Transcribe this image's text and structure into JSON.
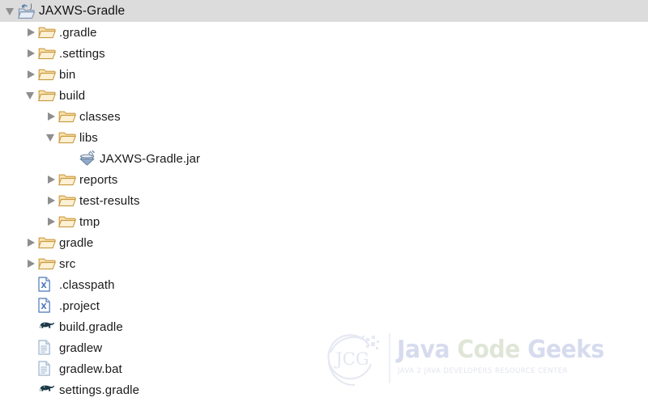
{
  "window": {
    "title": "JAXWS-Gradle"
  },
  "colors": {
    "header_band": "#dcdcdc",
    "background": "#ffffff",
    "text": "#1a1a1a",
    "twisty": "#8e8e8e",
    "folder_fill": "#fbe2b0",
    "folder_stroke": "#c99a3f",
    "xml_icon_accent": "#4a78b8",
    "gradle_icon": "#1c3a4a",
    "jar_icon": "#6f8fb5",
    "watermark_blue": "#d6dbee",
    "watermark_green": "#dfe6d8"
  },
  "tree": {
    "nodes": [
      {
        "label": "JAXWS-Gradle",
        "depth": 0,
        "icon": "java-project-folder-icon",
        "state": "expanded",
        "selected": true
      },
      {
        "label": ".gradle",
        "depth": 1,
        "icon": "folder-icon",
        "state": "collapsed",
        "selected": false
      },
      {
        "label": ".settings",
        "depth": 1,
        "icon": "folder-icon",
        "state": "collapsed",
        "selected": false
      },
      {
        "label": "bin",
        "depth": 1,
        "icon": "folder-icon",
        "state": "collapsed",
        "selected": false
      },
      {
        "label": "build",
        "depth": 1,
        "icon": "folder-icon",
        "state": "expanded",
        "selected": false
      },
      {
        "label": "classes",
        "depth": 2,
        "icon": "folder-icon",
        "state": "collapsed",
        "selected": false
      },
      {
        "label": "libs",
        "depth": 2,
        "icon": "folder-icon",
        "state": "expanded",
        "selected": false
      },
      {
        "label": "JAXWS-Gradle.jar",
        "depth": 3,
        "icon": "jar-icon",
        "state": "leaf",
        "selected": false
      },
      {
        "label": "reports",
        "depth": 2,
        "icon": "folder-icon",
        "state": "collapsed",
        "selected": false
      },
      {
        "label": "test-results",
        "depth": 2,
        "icon": "folder-icon",
        "state": "collapsed",
        "selected": false
      },
      {
        "label": "tmp",
        "depth": 2,
        "icon": "folder-icon",
        "state": "collapsed",
        "selected": false
      },
      {
        "label": "gradle",
        "depth": 1,
        "icon": "folder-icon",
        "state": "collapsed",
        "selected": false
      },
      {
        "label": "src",
        "depth": 1,
        "icon": "folder-icon",
        "state": "collapsed",
        "selected": false
      },
      {
        "label": ".classpath",
        "depth": 1,
        "icon": "xml-file-icon",
        "state": "leaf",
        "selected": false
      },
      {
        "label": ".project",
        "depth": 1,
        "icon": "xml-file-icon",
        "state": "leaf",
        "selected": false
      },
      {
        "label": "build.gradle",
        "depth": 1,
        "icon": "gradle-file-icon",
        "state": "leaf",
        "selected": false
      },
      {
        "label": "gradlew",
        "depth": 1,
        "icon": "text-file-icon",
        "state": "leaf",
        "selected": false
      },
      {
        "label": "gradlew.bat",
        "depth": 1,
        "icon": "text-file-icon",
        "state": "leaf",
        "selected": false
      },
      {
        "label": "settings.gradle",
        "depth": 1,
        "icon": "gradle-file-icon",
        "state": "leaf",
        "selected": false
      }
    ]
  },
  "watermark": {
    "logo_text": "JCG",
    "word1": "Java",
    "word2": "Code",
    "word3": "Geeks",
    "subtitle": "JAVA 2 JAVA DEVELOPERS RESOURCE CENTER"
  }
}
